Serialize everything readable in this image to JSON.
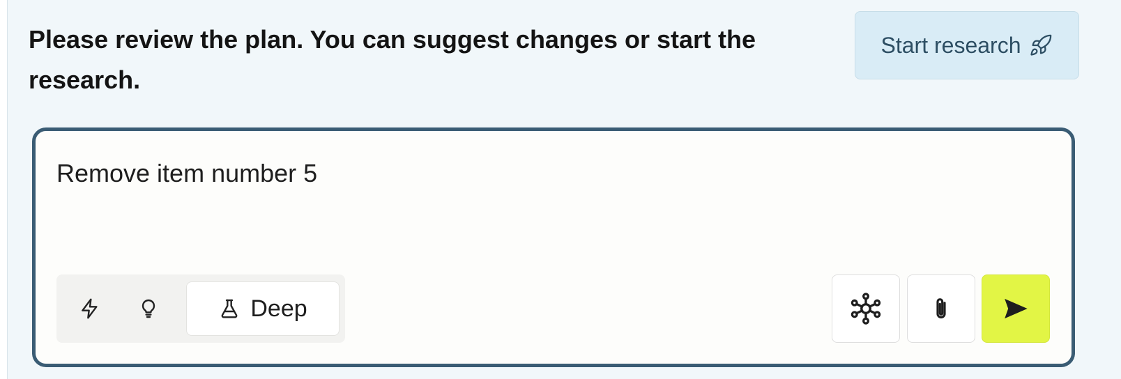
{
  "header": {
    "prompt": "Please review the plan. You can suggest changes or start the research.",
    "start_button_label": "Start research",
    "start_button_icon": "rocket-icon"
  },
  "composer": {
    "message_text": "Remove item number 5",
    "modes": [
      {
        "name": "fast",
        "icon": "lightning-icon",
        "selected": false
      },
      {
        "name": "think",
        "icon": "lightbulb-icon",
        "selected": false
      },
      {
        "name": "deep",
        "icon": "flask-icon",
        "label": "Deep",
        "selected": true
      }
    ],
    "tools": [
      {
        "name": "connectors",
        "icon": "network-icon"
      },
      {
        "name": "attach",
        "icon": "paperclip-icon"
      },
      {
        "name": "send",
        "icon": "send-icon"
      }
    ]
  },
  "colors": {
    "panel_background": "#f1f7fa",
    "start_button_background": "#d9ecf6",
    "start_button_text": "#2d4e63",
    "composer_border": "#3a5c74",
    "send_button_background": "#e2f545"
  }
}
